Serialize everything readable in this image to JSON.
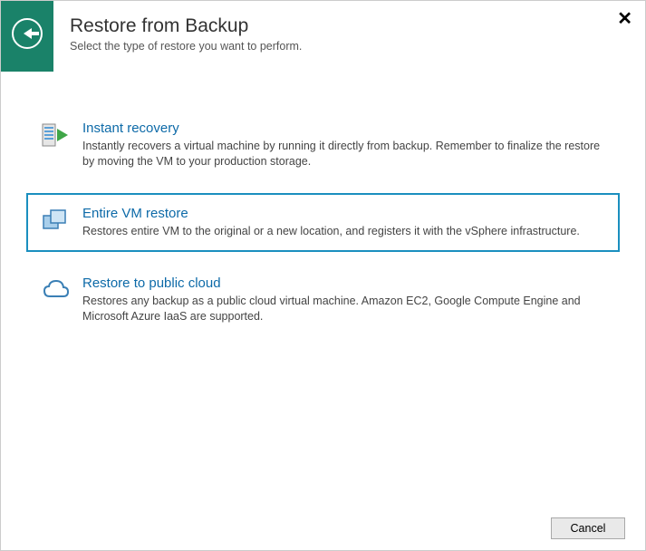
{
  "header": {
    "title": "Restore from Backup",
    "subtitle": "Select the type of restore you want to perform."
  },
  "options": [
    {
      "title": "Instant recovery",
      "desc": "Instantly recovers a virtual machine by running it directly from backup. Remember to finalize the restore by moving the VM to your production storage."
    },
    {
      "title": "Entire VM restore",
      "desc": "Restores entire VM to the original or a new location, and registers it with the vSphere infrastructure."
    },
    {
      "title": "Restore to public cloud",
      "desc": "Restores any backup as a public cloud virtual machine. Amazon EC2, Google Compute Engine and Microsoft Azure IaaS are supported."
    }
  ],
  "footer": {
    "cancel_label": "Cancel"
  }
}
